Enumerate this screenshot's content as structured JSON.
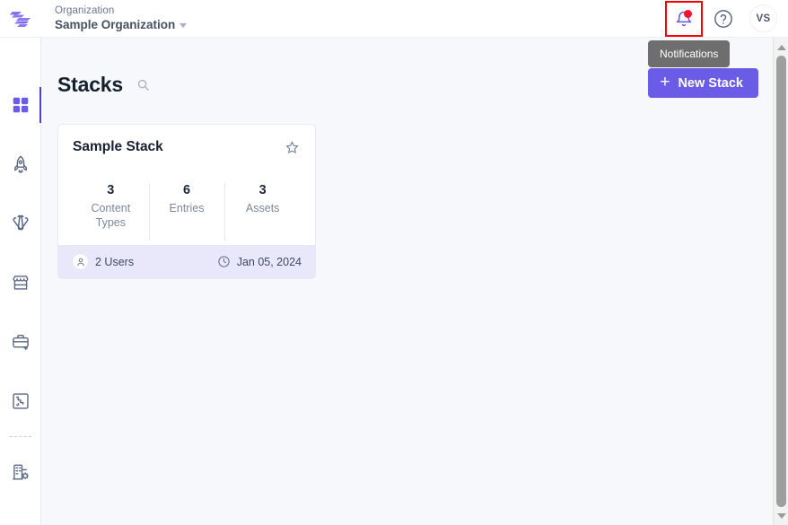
{
  "header": {
    "logo_icon": "contentstack-logo-icon",
    "org_label": "Organization",
    "org_name": "Sample Organization",
    "dropdown_icon": "chevron-down-icon",
    "notifications_icon": "bell-icon",
    "notifications_tooltip": "Notifications",
    "help_icon": "question-mark-circle-icon",
    "avatar_initials": "VS"
  },
  "sidebar": {
    "items": [
      {
        "name": "stacks",
        "icon": "grid-squares-icon",
        "active": true
      },
      {
        "name": "launch",
        "icon": "rocket-icon",
        "active": false
      },
      {
        "name": "automate",
        "icon": "automate-icon",
        "active": false
      },
      {
        "name": "marketplace",
        "icon": "storefront-icon",
        "active": false
      },
      {
        "name": "toolbox",
        "icon": "briefcase-plus-icon",
        "active": false
      },
      {
        "name": "apps",
        "icon": "puzzle-piece-icon",
        "active": false
      },
      {
        "name": "org-settings",
        "icon": "building-gear-icon",
        "active": false
      }
    ]
  },
  "main": {
    "page_title": "Stacks",
    "search_icon": "search-icon",
    "new_stack_button": {
      "label": "New Stack",
      "icon": "plus-icon",
      "color": "#6b5ce7"
    },
    "stacks": [
      {
        "title": "Sample Stack",
        "favorite_icon": "star-outline-icon",
        "stats": [
          {
            "value": "3",
            "label": "Content Types"
          },
          {
            "value": "6",
            "label": "Entries"
          },
          {
            "value": "3",
            "label": "Assets"
          }
        ],
        "users_icon": "user-icon",
        "users": "2 Users",
        "date_icon": "clock-icon",
        "date": "Jan 05, 2024"
      }
    ]
  },
  "scrollbar": {
    "up_icon": "triangle-up-icon",
    "down_icon": "triangle-down-icon"
  },
  "colors": {
    "accent": "#6b5ce7",
    "active_indicator": "#4a3fd4",
    "highlight_box": "#ff0000",
    "page_background": "#f7f8fc",
    "card_footer": "#e9e8fa"
  }
}
